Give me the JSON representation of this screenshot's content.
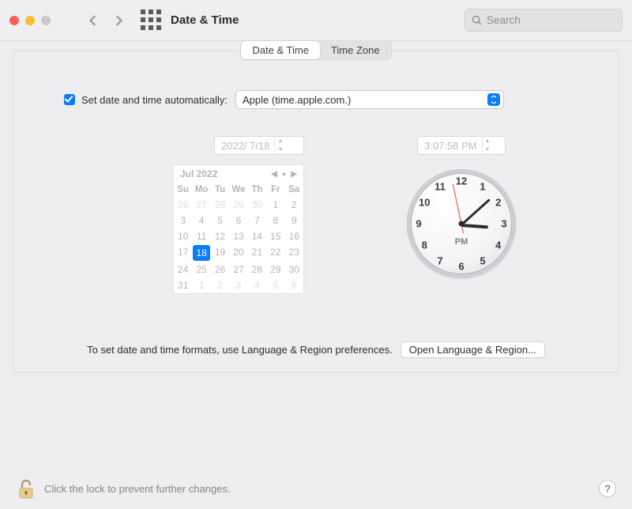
{
  "window_title": "Date & Time",
  "search_placeholder": "Search",
  "tabs": {
    "datetime": "Date & Time",
    "timezone": "Time Zone"
  },
  "auto": {
    "label": "Set date and time automatically:",
    "checked": true,
    "server": "Apple (time.apple.com.)"
  },
  "date_field": "2022/  7/18",
  "time_field": "3:07:58 PM",
  "calendar": {
    "title": "Jul 2022",
    "weekdays": [
      "Su",
      "Mo",
      "Tu",
      "We",
      "Th",
      "Fr",
      "Sa"
    ],
    "leading": [
      26,
      27,
      28,
      29,
      30
    ],
    "days": [
      1,
      2,
      3,
      4,
      5,
      6,
      7,
      8,
      9,
      10,
      11,
      12,
      13,
      14,
      15,
      16,
      17,
      18,
      19,
      20,
      21,
      22,
      23,
      24,
      25,
      26,
      27,
      28,
      29,
      30,
      31
    ],
    "trailing": [
      1,
      2,
      3,
      4,
      5,
      6
    ],
    "selected": 18
  },
  "clock": {
    "hours": 3,
    "minutes": 8,
    "seconds": 58,
    "ampm": "PM"
  },
  "hint_text": "To set date and time formats, use Language & Region preferences.",
  "open_lr": "Open Language & Region...",
  "footer_text": "Click the lock to prevent further changes.",
  "help": "?"
}
